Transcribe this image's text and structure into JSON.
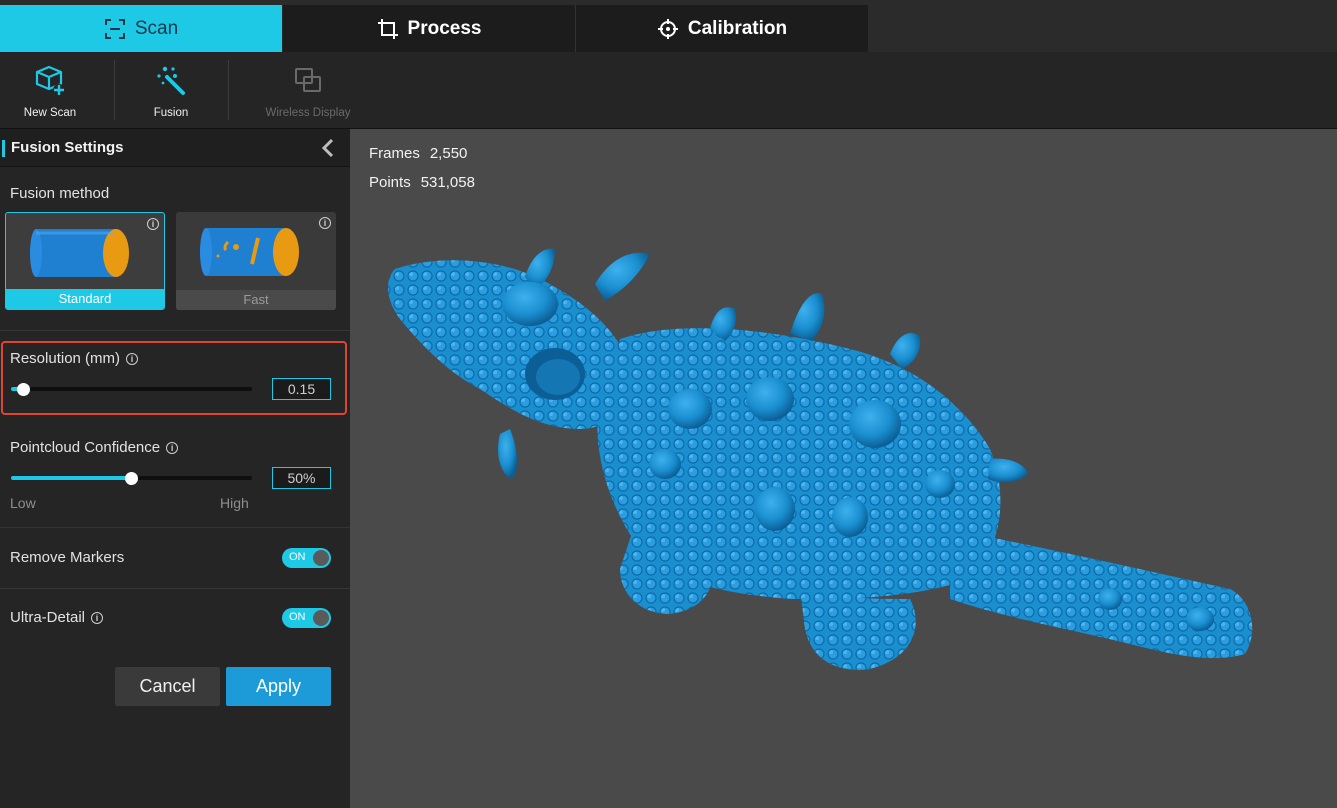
{
  "tabs": [
    {
      "label": "Scan",
      "icon": "scan-frame-icon",
      "active": true
    },
    {
      "label": "Process",
      "icon": "crop-icon",
      "active": false
    },
    {
      "label": "Calibration",
      "icon": "crosshair-icon",
      "active": false
    }
  ],
  "toolbar": {
    "new_scan": "New Scan",
    "fusion": "Fusion",
    "wireless_display": "Wireless Display"
  },
  "panel": {
    "title": "Fusion Settings",
    "fusion_method_label": "Fusion method",
    "methods": {
      "standard": "Standard",
      "fast": "Fast"
    },
    "resolution": {
      "label": "Resolution (mm)",
      "value": "0.15",
      "fraction": 0.05
    },
    "confidence": {
      "label": "Pointcloud Confidence",
      "value": "50%",
      "fraction": 0.5,
      "low": "Low",
      "high": "High"
    },
    "remove_markers": {
      "label": "Remove Markers",
      "state": "ON"
    },
    "ultra_detail": {
      "label": "Ultra-Detail",
      "state": "ON"
    },
    "cancel": "Cancel",
    "apply": "Apply"
  },
  "viewport": {
    "frames_label": "Frames",
    "frames_value": "2,550",
    "points_label": "Points",
    "points_value": "531,058"
  },
  "colors": {
    "accent": "#1ec9e6",
    "apply": "#1d9bd8",
    "highlight": "#e0442c",
    "model": "#1a8fd0"
  }
}
